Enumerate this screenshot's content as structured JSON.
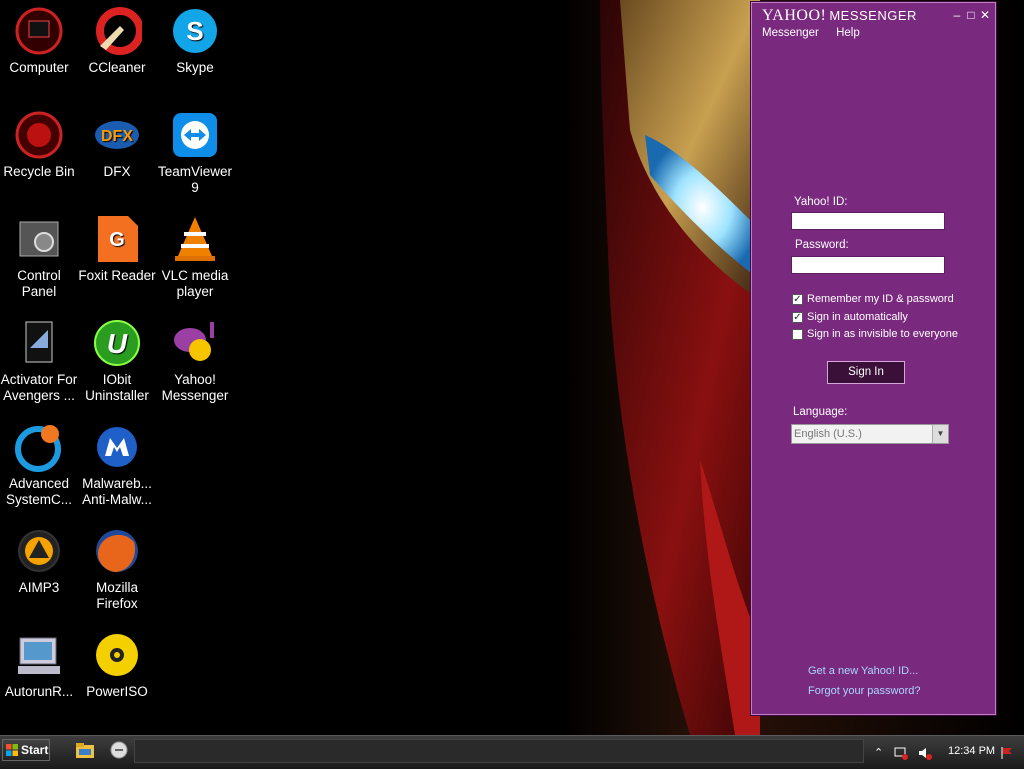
{
  "desktop": {
    "icons": [
      {
        "label": "Computer",
        "icon": "computer-icon"
      },
      {
        "label": "CCleaner",
        "icon": "ccleaner-icon"
      },
      {
        "label": "Skype",
        "icon": "skype-icon"
      },
      {
        "label": "Recycle Bin",
        "icon": "recycle-bin-icon"
      },
      {
        "label": "DFX",
        "icon": "dfx-icon"
      },
      {
        "label": "TeamViewer\n9",
        "icon": "teamviewer-icon"
      },
      {
        "label": "Control\nPanel",
        "icon": "control-panel-icon"
      },
      {
        "label": "Foxit Reader",
        "icon": "foxit-reader-icon"
      },
      {
        "label": "VLC media\nplayer",
        "icon": "vlc-icon"
      },
      {
        "label": "Activator For\nAvengers ...",
        "icon": "activator-icon"
      },
      {
        "label": "IObit\nUninstaller",
        "icon": "iobit-icon"
      },
      {
        "label": "Yahoo!\nMessenger",
        "icon": "yahoo-messenger-icon"
      },
      {
        "label": "Advanced\nSystemC...",
        "icon": "advanced-systemcare-icon"
      },
      {
        "label": "Malwareb...\nAnti-Malw...",
        "icon": "malwarebytes-icon"
      },
      {
        "label": "AIMP3",
        "icon": "aimp-icon"
      },
      {
        "label": "Mozilla\nFirefox",
        "icon": "firefox-icon"
      },
      {
        "label": "AutorunR...",
        "icon": "autorun-icon"
      },
      {
        "label": "PowerISO",
        "icon": "poweriso-icon"
      }
    ]
  },
  "messenger": {
    "title_brand": "YAHOO!",
    "title_suffix": "MESSENGER",
    "menu": [
      "Messenger",
      "Help"
    ],
    "yahoo_id_label": "Yahoo! ID:",
    "yahoo_id_value": "",
    "password_label": "Password:",
    "password_value": "",
    "checkboxes": [
      {
        "label": "Remember my ID & password",
        "checked": true
      },
      {
        "label": "Sign in automatically",
        "checked": true
      },
      {
        "label": "Sign in as invisible to everyone",
        "checked": false
      }
    ],
    "signin_label": "Sign In",
    "language_label": "Language:",
    "language_value": "English (U.S.)",
    "links": [
      "Get a new Yahoo! ID...",
      "Forgot your password?"
    ],
    "colors": {
      "window": "#7a2a7e",
      "link": "#a8d6ff"
    }
  },
  "taskbar": {
    "start_label": "Start",
    "clock": "12:34 PM"
  }
}
